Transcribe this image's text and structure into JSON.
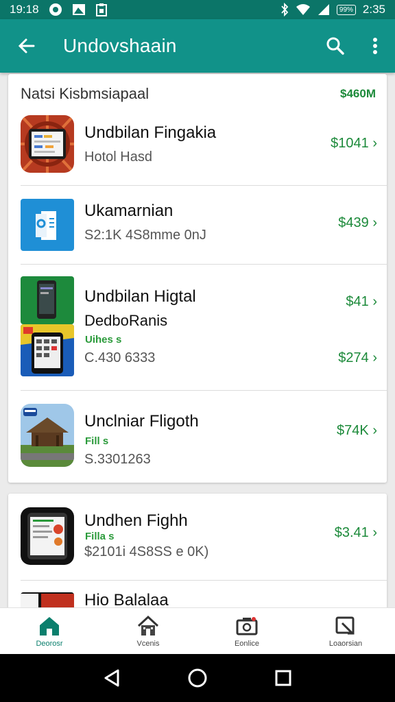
{
  "status_bar": {
    "time": "19:18",
    "right_time": "2:35",
    "battery_label": "99%"
  },
  "app_bar": {
    "title": "Undovshaain"
  },
  "section": {
    "title": "Natsi Kisbmsiapaal",
    "total": "$460M"
  },
  "items": [
    {
      "name": "Undbilan Fingakia",
      "sub": "Hotol Hasd",
      "price": "$1041"
    },
    {
      "name": "Ukamarnian",
      "sub": "S2:1K 4S8mme 0nJ",
      "price": "$439"
    },
    {
      "name": "Undbilan Higtal",
      "name2": "DedboRanis",
      "tag": "Uihes s",
      "price_top": "$41",
      "sub": "C.430 6333",
      "price": "$274"
    },
    {
      "name": "Unclniar Fligoth",
      "tag": "Fill s",
      "sub": "S.3301263",
      "price": "$74K"
    },
    {
      "name": "Undhen Fighh",
      "tag": "Filla s",
      "sub": "$2101i 4S8SS e 0K)",
      "price": "$3.41"
    },
    {
      "name": "Hio Balalaa"
    }
  ],
  "bottom_nav": [
    {
      "label": "Deorosr",
      "icon": "home-icon"
    },
    {
      "label": "Vcenis",
      "icon": "house-icon"
    },
    {
      "label": "Eonlice",
      "icon": "camera-icon"
    },
    {
      "label": "Loaorsian",
      "icon": "frame-icon"
    }
  ],
  "colors": {
    "app_bar": "#119289",
    "status_bar": "#0b7568",
    "price": "#1c8a3a"
  }
}
